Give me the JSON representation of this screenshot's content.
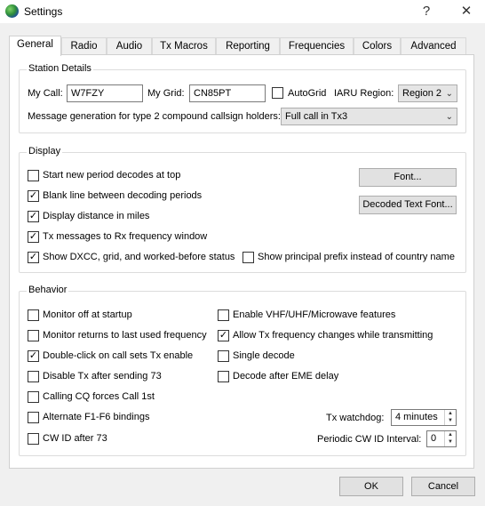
{
  "window": {
    "title": "Settings",
    "help_glyph": "?",
    "close_glyph": "✕"
  },
  "tabs": [
    {
      "label": "General"
    },
    {
      "label": "Radio"
    },
    {
      "label": "Audio"
    },
    {
      "label": "Tx Macros"
    },
    {
      "label": "Reporting"
    },
    {
      "label": "Frequencies"
    },
    {
      "label": "Colors"
    },
    {
      "label": "Advanced"
    }
  ],
  "station": {
    "group_title": "Station Details",
    "my_call_label": "My Call:",
    "my_call_value": "W7FZY",
    "my_grid_label": "My Grid:",
    "my_grid_value": "CN85PT",
    "autogrid_label": "AutoGrid",
    "iaru_label": "IARU Region:",
    "iaru_value": "Region 2",
    "msg_gen_label": "Message generation for type 2 compound callsign holders:",
    "msg_gen_value": "Full call in Tx3"
  },
  "display": {
    "group_title": "Display",
    "items": [
      {
        "label": "Start new period decodes at top",
        "checked": false
      },
      {
        "label": "Blank line between decoding periods",
        "checked": true
      },
      {
        "label": "Display distance in miles",
        "checked": true
      },
      {
        "label": "Tx messages to Rx frequency window",
        "checked": true
      },
      {
        "label": "Show DXCC, grid, and worked-before status",
        "checked": true
      }
    ],
    "principal_prefix_label": "Show principal prefix instead of country name",
    "principal_prefix_checked": false,
    "font_button": "Font...",
    "decoded_font_button": "Decoded Text Font..."
  },
  "behavior": {
    "group_title": "Behavior",
    "left": [
      {
        "label": "Monitor off at startup",
        "checked": false
      },
      {
        "label": "Monitor returns to last used frequency",
        "checked": false
      },
      {
        "label": "Double-click on call sets Tx enable",
        "checked": true
      },
      {
        "label": "Disable Tx after sending 73",
        "checked": false
      },
      {
        "label": "Calling CQ forces Call 1st",
        "checked": false
      },
      {
        "label": "Alternate F1-F6 bindings",
        "checked": false
      },
      {
        "label": "CW ID after 73",
        "checked": false
      }
    ],
    "right": [
      {
        "label": "Enable VHF/UHF/Microwave features",
        "checked": false
      },
      {
        "label": "Allow Tx frequency changes while transmitting",
        "checked": true
      },
      {
        "label": "Single decode",
        "checked": false
      },
      {
        "label": "Decode after EME delay",
        "checked": false
      }
    ],
    "tx_watchdog_label": "Tx watchdog:",
    "tx_watchdog_value": "4 minutes",
    "cw_id_interval_label": "Periodic CW ID Interval:",
    "cw_id_interval_value": "0"
  },
  "footer": {
    "ok_label": "OK",
    "cancel_label": "Cancel"
  }
}
